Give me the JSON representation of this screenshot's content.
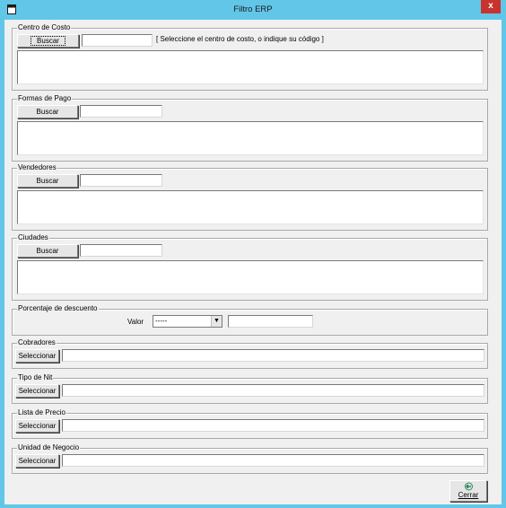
{
  "window": {
    "title": "Filtro ERP",
    "close_glyph": "x"
  },
  "centro_costo": {
    "legend": "Centro de Costo",
    "search_label": "Buscar",
    "code_value": "",
    "hint": "[   Seleccione el centro de costo, o indique su código   ]"
  },
  "formas_pago": {
    "legend": "Formas de Pago",
    "search_label": "Buscar",
    "code_value": ""
  },
  "vendedores": {
    "legend": "Vendedores",
    "search_label": "Buscar",
    "code_value": ""
  },
  "ciudades": {
    "legend": "Ciudades",
    "search_label": "Buscar",
    "code_value": ""
  },
  "porcentaje": {
    "legend": "Porcentaje de descuento",
    "valor_label": "Valor",
    "operator_selected": "-----",
    "value": ""
  },
  "cobradores": {
    "legend": "Cobradores",
    "select_label": "Seleccionar",
    "value": ""
  },
  "tipo_nit": {
    "legend": "Tipo de Nit",
    "select_label": "Seleccionar",
    "value": ""
  },
  "lista_precio": {
    "legend": "Lista de Precio",
    "select_label": "Seleccionar",
    "value": ""
  },
  "unidad_negocio": {
    "legend": "Unidad de Negocio",
    "select_label": "Seleccionar",
    "value": ""
  },
  "footer": {
    "close_label": "Cerrar"
  },
  "colors": {
    "titlebar": "#62c6e8",
    "close_button": "#c7332d",
    "window_bg": "#f0f0f0"
  },
  "icons": {
    "app": "window-app-icon",
    "close": "close-icon",
    "cerrar": "exit-arrow-icon"
  }
}
